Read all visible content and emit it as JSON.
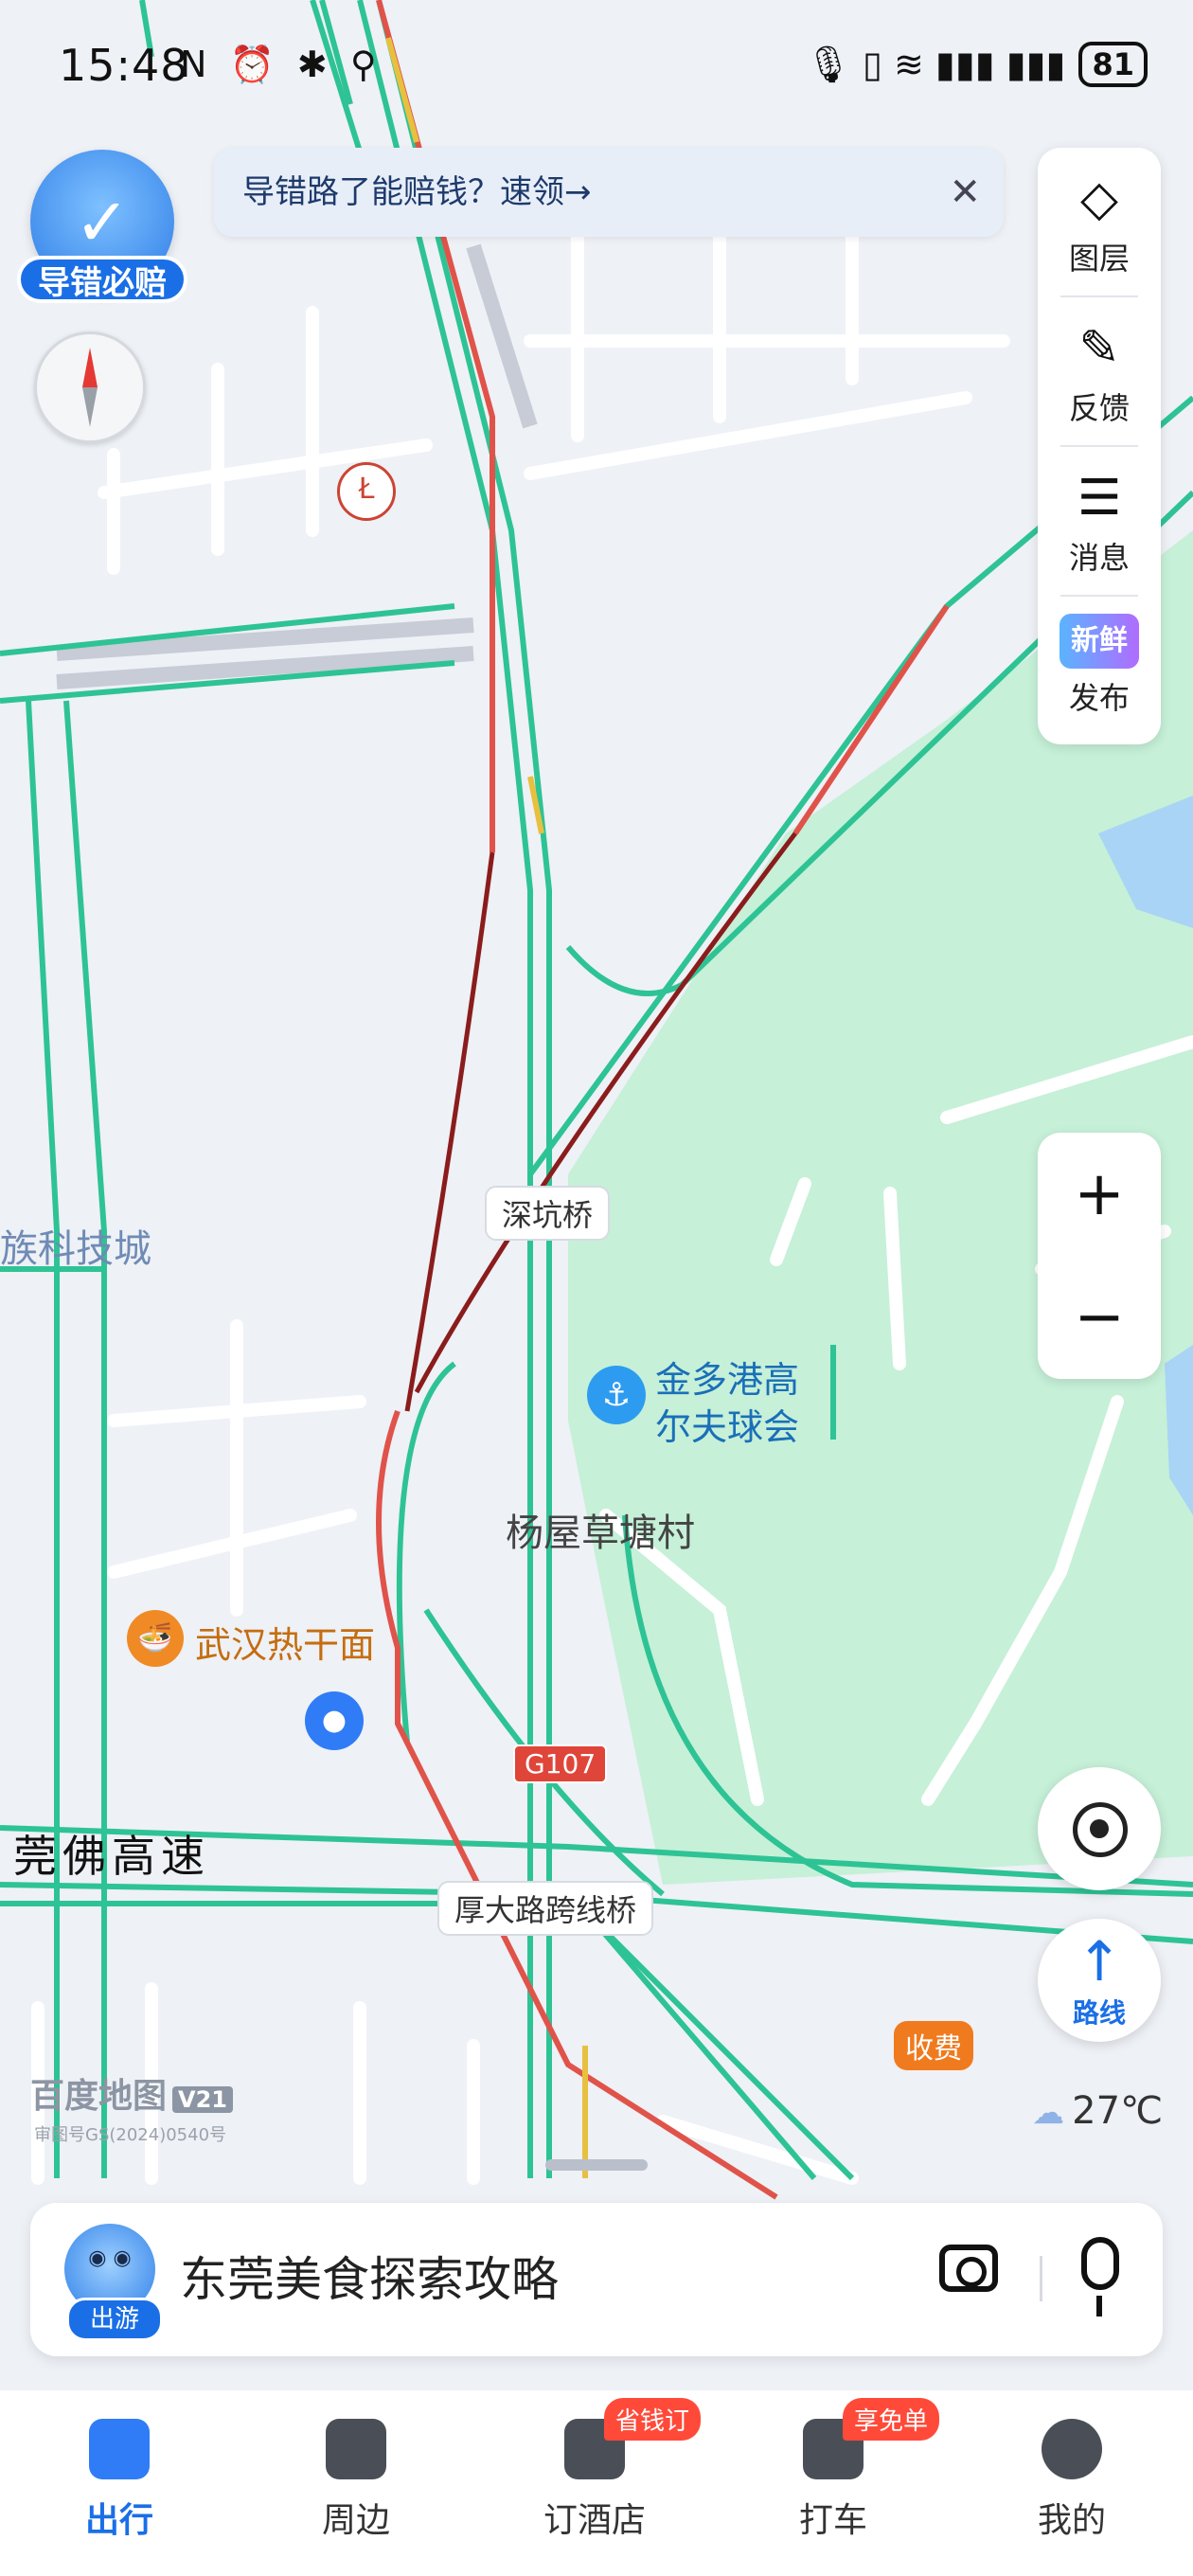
{
  "status_bar": {
    "time": "15:48",
    "left_icons": "N ⏰ ✱ ⚲",
    "right_icons": "🎙 ▯ ≋ ▮▮▮ ▮▮▮",
    "battery": "81"
  },
  "guarantee_badge": {
    "label": "导错必赔"
  },
  "promo_banner": {
    "text": "导错路了能赔钱？速领→",
    "close_symbol": "✕"
  },
  "right_panel": {
    "items": [
      {
        "label": "图层",
        "icon": "layers-icon",
        "glyph": "◇"
      },
      {
        "label": "反馈",
        "icon": "feedback-edit-icon",
        "glyph": "✎"
      },
      {
        "label": "消息",
        "icon": "message-icon",
        "glyph": "☰"
      },
      {
        "label": "发布",
        "icon": "new-thing-icon",
        "glyph": "新鲜事"
      }
    ]
  },
  "zoom": {
    "in": "+",
    "out": "−"
  },
  "route_button": {
    "arrow": "↑",
    "label": "路线"
  },
  "map_labels": {
    "bridge_shenkeng": "深坑桥",
    "golf_club_line1": "金多港高",
    "golf_club_line2": "尔夫球会",
    "village": "杨屋草塘村",
    "restaurant": "武汉热干面",
    "highway_g107": "G107",
    "expressway": "莞佛高速",
    "bridge_houda": "厚大路跨线桥",
    "tech_city": "族科技城",
    "toll": "收费"
  },
  "weather": {
    "temp": "27℃"
  },
  "brand": {
    "name": "百度地图",
    "version": "V21",
    "permit": "审图号GS(2024)0540号"
  },
  "search": {
    "avatar_tag": "出游",
    "placeholder_text": "东莞美食探索攻略"
  },
  "tabs": [
    {
      "label": "出行",
      "active": true
    },
    {
      "label": "周边",
      "active": false
    },
    {
      "label": "订酒店",
      "badge": "省钱订",
      "active": false
    },
    {
      "label": "打车",
      "badge": "享免单",
      "active": false
    },
    {
      "label": "我的",
      "active": false
    }
  ],
  "colors": {
    "road_green": "#2ec394",
    "road_red": "#e0534a",
    "road_darkred": "#8b1c1c",
    "park_green": "#c6f0d8",
    "accent_blue": "#1a6fe6"
  }
}
